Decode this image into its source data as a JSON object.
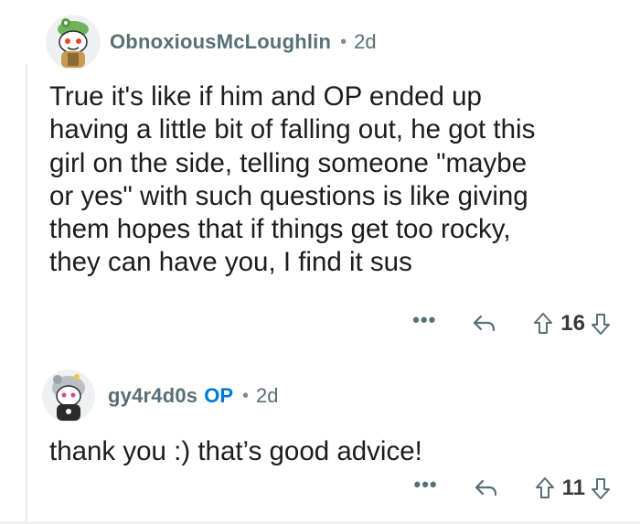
{
  "comments": [
    {
      "username": "ObnoxiousMcLoughlin",
      "separator": "•",
      "time": "2d",
      "body": "True it's like if him and OP ended up\nhaving a little bit of falling out, he got this\ngirl on the side, telling someone \"maybe\nor yes\" with such questions is like giving\nthem hopes that if things get too rocky,\nthey can have you, I find it sus",
      "more": "•••",
      "score": "16",
      "avatar_icon": "snoo-avatar-green-hat-icon"
    },
    {
      "username": "gy4r4d0s",
      "badge": "OP",
      "separator": "•",
      "time": "2d",
      "body": "thank you :) that’s good advice!",
      "more": "•••",
      "score": "11",
      "avatar_icon": "snoo-avatar-gray-hair-icon"
    }
  ],
  "colors": {
    "username": "#576f76",
    "op_badge": "#0079d3",
    "body_text": "#1c1c1c",
    "thread_line": "#e6e8ea"
  }
}
